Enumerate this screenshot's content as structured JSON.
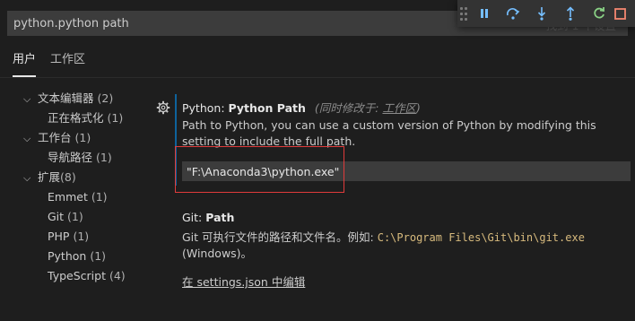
{
  "search": {
    "value": "python.python path",
    "ghost": "找到 1 个设置"
  },
  "debug_toolbar": {
    "buttons": [
      {
        "icon": "pause-icon",
        "label": "pause"
      },
      {
        "icon": "step-over-icon",
        "label": "step over"
      },
      {
        "icon": "step-into-icon",
        "label": "step into"
      },
      {
        "icon": "step-out-icon",
        "label": "step out"
      },
      {
        "icon": "restart-icon",
        "label": "restart"
      },
      {
        "icon": "stop-icon",
        "label": "stop"
      }
    ],
    "colors": {
      "blue": "#75beff",
      "green": "#89d185",
      "red": "#f48771"
    }
  },
  "tabs": [
    {
      "label": "用户",
      "active": true
    },
    {
      "label": "工作区",
      "active": false
    }
  ],
  "toc": [
    {
      "label": "文本编辑器",
      "count": "(2)",
      "level": 1,
      "expanded": true
    },
    {
      "label": "正在格式化",
      "count": "(1)",
      "level": 2
    },
    {
      "label": "工作台",
      "count": "(1)",
      "level": 1,
      "expanded": true
    },
    {
      "label": "导航路径",
      "count": "(1)",
      "level": 2
    },
    {
      "label": "扩展",
      "count": "(8)",
      "level": 1,
      "expanded": true
    },
    {
      "label": "Emmet",
      "count": "(1)",
      "level": 2
    },
    {
      "label": "Git",
      "count": "(1)",
      "level": 2
    },
    {
      "label": "PHP",
      "count": "(1)",
      "level": 2
    },
    {
      "label": "Python",
      "count": "(1)",
      "level": 2
    },
    {
      "label": "TypeScript",
      "count": "(4)",
      "level": 2
    }
  ],
  "settings": {
    "python_path": {
      "category": "Python: ",
      "name": "Python Path",
      "modified_prefix": "(同时修改于: ",
      "modified_link": "工作区",
      "modified_suffix": ")",
      "description": "Path to Python, you can use a custom version of Python by modifying this setting to include the full path.",
      "value": "\"F:\\Anaconda3\\python.exe\""
    },
    "git_path": {
      "category": "Git: ",
      "name": "Path",
      "desc_before": "Git 可执行文件的路径和文件名。例如: ",
      "desc_code": "C:\\Program Files\\Git\\bin\\git.exe",
      "desc_after": " (Windows)。",
      "link": "在 settings.json 中编辑"
    }
  },
  "colors": {
    "accent": "#0e639c",
    "highlight": "#e03b3b",
    "code": "#d7ba7d"
  }
}
